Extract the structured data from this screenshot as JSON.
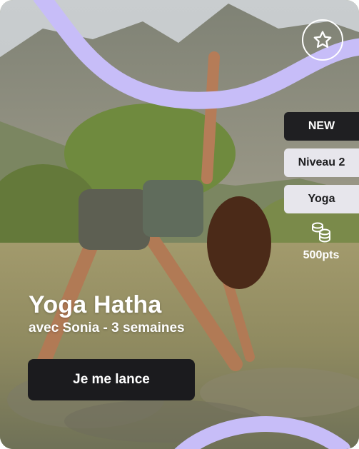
{
  "card": {
    "title": "Yoga Hatha",
    "subtitle": "avec Sonia - 3 semaines",
    "cta_label": "Je me lance",
    "badges": [
      {
        "label": "NEW",
        "style": "dark"
      },
      {
        "label": "Niveau 2",
        "style": "light"
      },
      {
        "label": "Yoga",
        "style": "light"
      }
    ],
    "points": "500pts",
    "favorite_icon": "star-icon",
    "points_icon": "coins-icon",
    "accent_color": "#c7bdf8"
  }
}
